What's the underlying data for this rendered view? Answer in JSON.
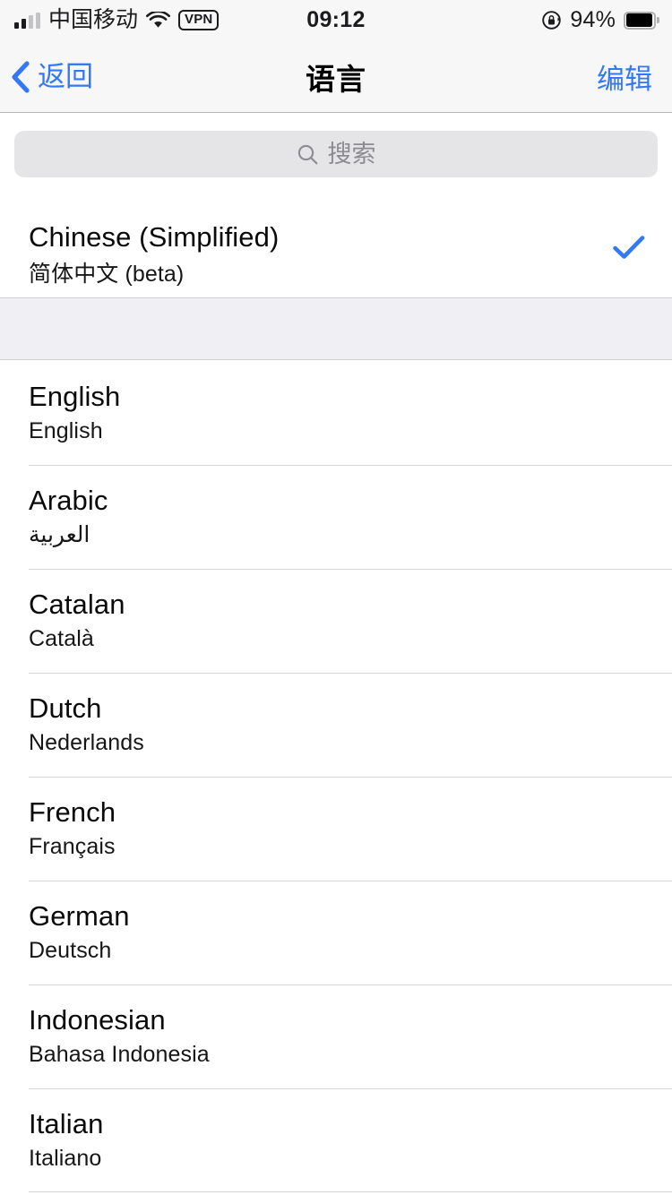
{
  "status_bar": {
    "carrier": "中国移动",
    "signal_bars_filled": 2,
    "signal_bars_total": 4,
    "wifi_icon": "wifi-icon",
    "vpn_badge": "VPN",
    "time": "09:12",
    "rotation_lock_icon": "rotation-lock-icon",
    "battery_percent": "94%",
    "battery_level": 94
  },
  "nav_bar": {
    "back_label": "返回",
    "back_icon": "chevron-left-icon",
    "title": "语言",
    "edit_label": "编辑"
  },
  "search": {
    "placeholder": "搜索",
    "value": "",
    "icon": "search-icon"
  },
  "selected_language": {
    "name": "Chinese (Simplified)",
    "native": "简体中文 (beta)",
    "checked": true,
    "check_icon": "checkmark-icon"
  },
  "languages": [
    {
      "name": "English",
      "native": "English"
    },
    {
      "name": "Arabic",
      "native": "العربية"
    },
    {
      "name": "Catalan",
      "native": "Català"
    },
    {
      "name": "Dutch",
      "native": "Nederlands"
    },
    {
      "name": "French",
      "native": "Français"
    },
    {
      "name": "German",
      "native": "Deutsch"
    },
    {
      "name": "Indonesian",
      "native": "Bahasa Indonesia"
    },
    {
      "name": "Italian",
      "native": "Italiano"
    }
  ],
  "colors": {
    "accent": "#3478f6",
    "nav_bg": "#f7f7f7",
    "group_gap_bg": "#efeff4",
    "search_bg": "#e5e5e7",
    "separator": "#d6d6d8",
    "text_primary": "#0a0a0a",
    "placeholder": "#8b8b90"
  }
}
